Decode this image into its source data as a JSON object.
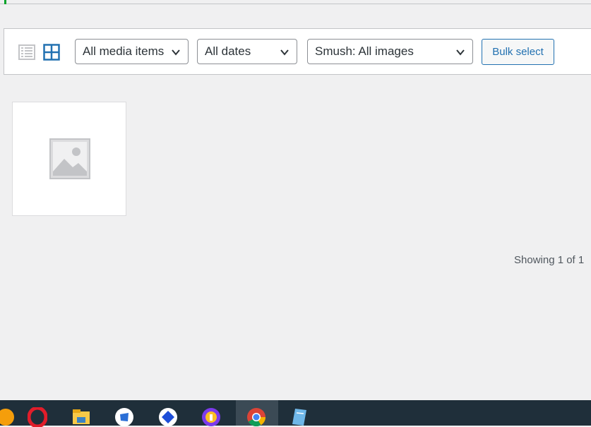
{
  "toolbar": {
    "view_modes": {
      "list": "list-view-icon",
      "grid": "grid-view-icon",
      "active": "grid"
    },
    "filters": {
      "type_selected": "All media items",
      "date_selected": "All dates",
      "smush_selected": "Smush: All images"
    },
    "bulk_select_label": "Bulk select"
  },
  "media": {
    "items": [
      {
        "icon": "image-placeholder-icon"
      }
    ]
  },
  "status": {
    "showing_text": "Showing 1 of 1"
  },
  "taskbar": {
    "apps": [
      {
        "icon": "orange-app-icon"
      },
      {
        "icon": "opera-icon"
      },
      {
        "icon": "file-explorer-icon"
      },
      {
        "icon": "blue-app-icon"
      },
      {
        "icon": "teamviewer-icon"
      },
      {
        "icon": "vpn-icon"
      },
      {
        "icon": "chrome-icon",
        "active": true
      },
      {
        "icon": "notepad-icon"
      }
    ]
  },
  "colors": {
    "accent": "#2271b1",
    "notice_green": "#00a32a",
    "background": "#f0f0f1",
    "taskbar": "#1f2f3a"
  }
}
